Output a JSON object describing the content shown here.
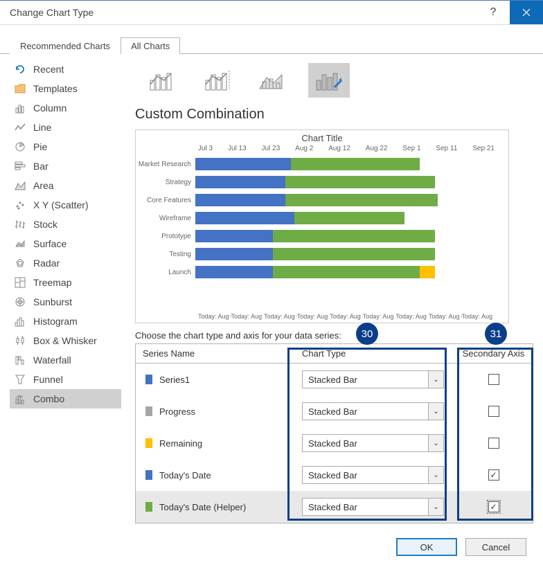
{
  "titlebar": {
    "title": "Change Chart Type"
  },
  "tabs": {
    "recommended": "Recommended Charts",
    "all": "All Charts"
  },
  "sidebar": {
    "items": [
      {
        "label": "Recent"
      },
      {
        "label": "Templates"
      },
      {
        "label": "Column"
      },
      {
        "label": "Line"
      },
      {
        "label": "Pie"
      },
      {
        "label": "Bar"
      },
      {
        "label": "Area"
      },
      {
        "label": "X Y (Scatter)"
      },
      {
        "label": "Stock"
      },
      {
        "label": "Surface"
      },
      {
        "label": "Radar"
      },
      {
        "label": "Treemap"
      },
      {
        "label": "Sunburst"
      },
      {
        "label": "Histogram"
      },
      {
        "label": "Box & Whisker"
      },
      {
        "label": "Waterfall"
      },
      {
        "label": "Funnel"
      },
      {
        "label": "Combo"
      }
    ]
  },
  "section_title": "Custom Combination",
  "chart": {
    "title": "Chart Title",
    "dates": [
      "Jul 3",
      "Jul 13",
      "Jul 23",
      "Aug 2",
      "Aug 12",
      "Aug 22",
      "Sep 1",
      "Sep 11",
      "Sep 21"
    ],
    "rows": [
      "Market Research",
      "Strategy",
      "Core Features",
      "Wireframe",
      "Prototype",
      "Testing",
      "Launch"
    ],
    "footer_item": "Today: Aug 6"
  },
  "choose_label": "Choose the chart type and axis for your data series:",
  "table": {
    "head": {
      "name": "Series Name",
      "type": "Chart Type",
      "axis": "Secondary Axis"
    },
    "rows": [
      {
        "name": "Series1",
        "type": "Stacked Bar",
        "color": "#4472c4",
        "checked": false
      },
      {
        "name": "Progress",
        "type": "Stacked Bar",
        "color": "#a6a6a6",
        "checked": false
      },
      {
        "name": "Remaining",
        "type": "Stacked Bar",
        "color": "#ffc000",
        "checked": false
      },
      {
        "name": "Today's Date",
        "type": "Stacked Bar",
        "color": "#4472c4",
        "checked": true
      },
      {
        "name": "Today's Date (Helper)",
        "type": "Stacked Bar",
        "color": "#6fac45",
        "checked": true
      }
    ]
  },
  "footer": {
    "ok": "OK",
    "cancel": "Cancel"
  },
  "callouts": {
    "c30": "30",
    "c31": "31"
  },
  "chart_data": {
    "type": "bar",
    "title": "Chart Title",
    "xlabel": "",
    "ylabel": "",
    "x_ticks": [
      "Jul 3",
      "Jul 13",
      "Jul 23",
      "Aug 2",
      "Aug 12",
      "Aug 22",
      "Sep 1",
      "Sep 11",
      "Sep 21"
    ],
    "categories": [
      "Market Research",
      "Strategy",
      "Core Features",
      "Wireframe",
      "Prototype",
      "Testing",
      "Launch"
    ],
    "series": [
      {
        "name": "Series1",
        "color": "#4472c4",
        "values_start": [
          0,
          0,
          0,
          0,
          0,
          0,
          0
        ],
        "values_width": [
          32,
          30,
          30,
          33,
          26,
          26,
          26
        ]
      },
      {
        "name": "Progress/Green",
        "color": "#6fac45",
        "values_start": [
          32,
          30,
          30,
          33,
          26,
          26,
          26
        ],
        "values_width": [
          43,
          50,
          51,
          37,
          54,
          54,
          49
        ]
      },
      {
        "name": "Remaining",
        "color": "#ffc000",
        "values_start": [
          0,
          0,
          0,
          0,
          0,
          0,
          75
        ],
        "values_width": [
          0,
          0,
          0,
          0,
          0,
          0,
          5
        ]
      }
    ],
    "footer_labels": [
      "Today: Aug 6",
      "Today: Aug 6",
      "Today: Aug 6",
      "Today: Aug 6",
      "Today: Aug 6",
      "Today: Aug 6",
      "Today: Aug 6",
      "Today: Aug 6",
      "Today: Aug 6"
    ],
    "notes": "Horizontal stacked bar Gantt-style preview; values are approximate % of chart width read from pixels."
  }
}
